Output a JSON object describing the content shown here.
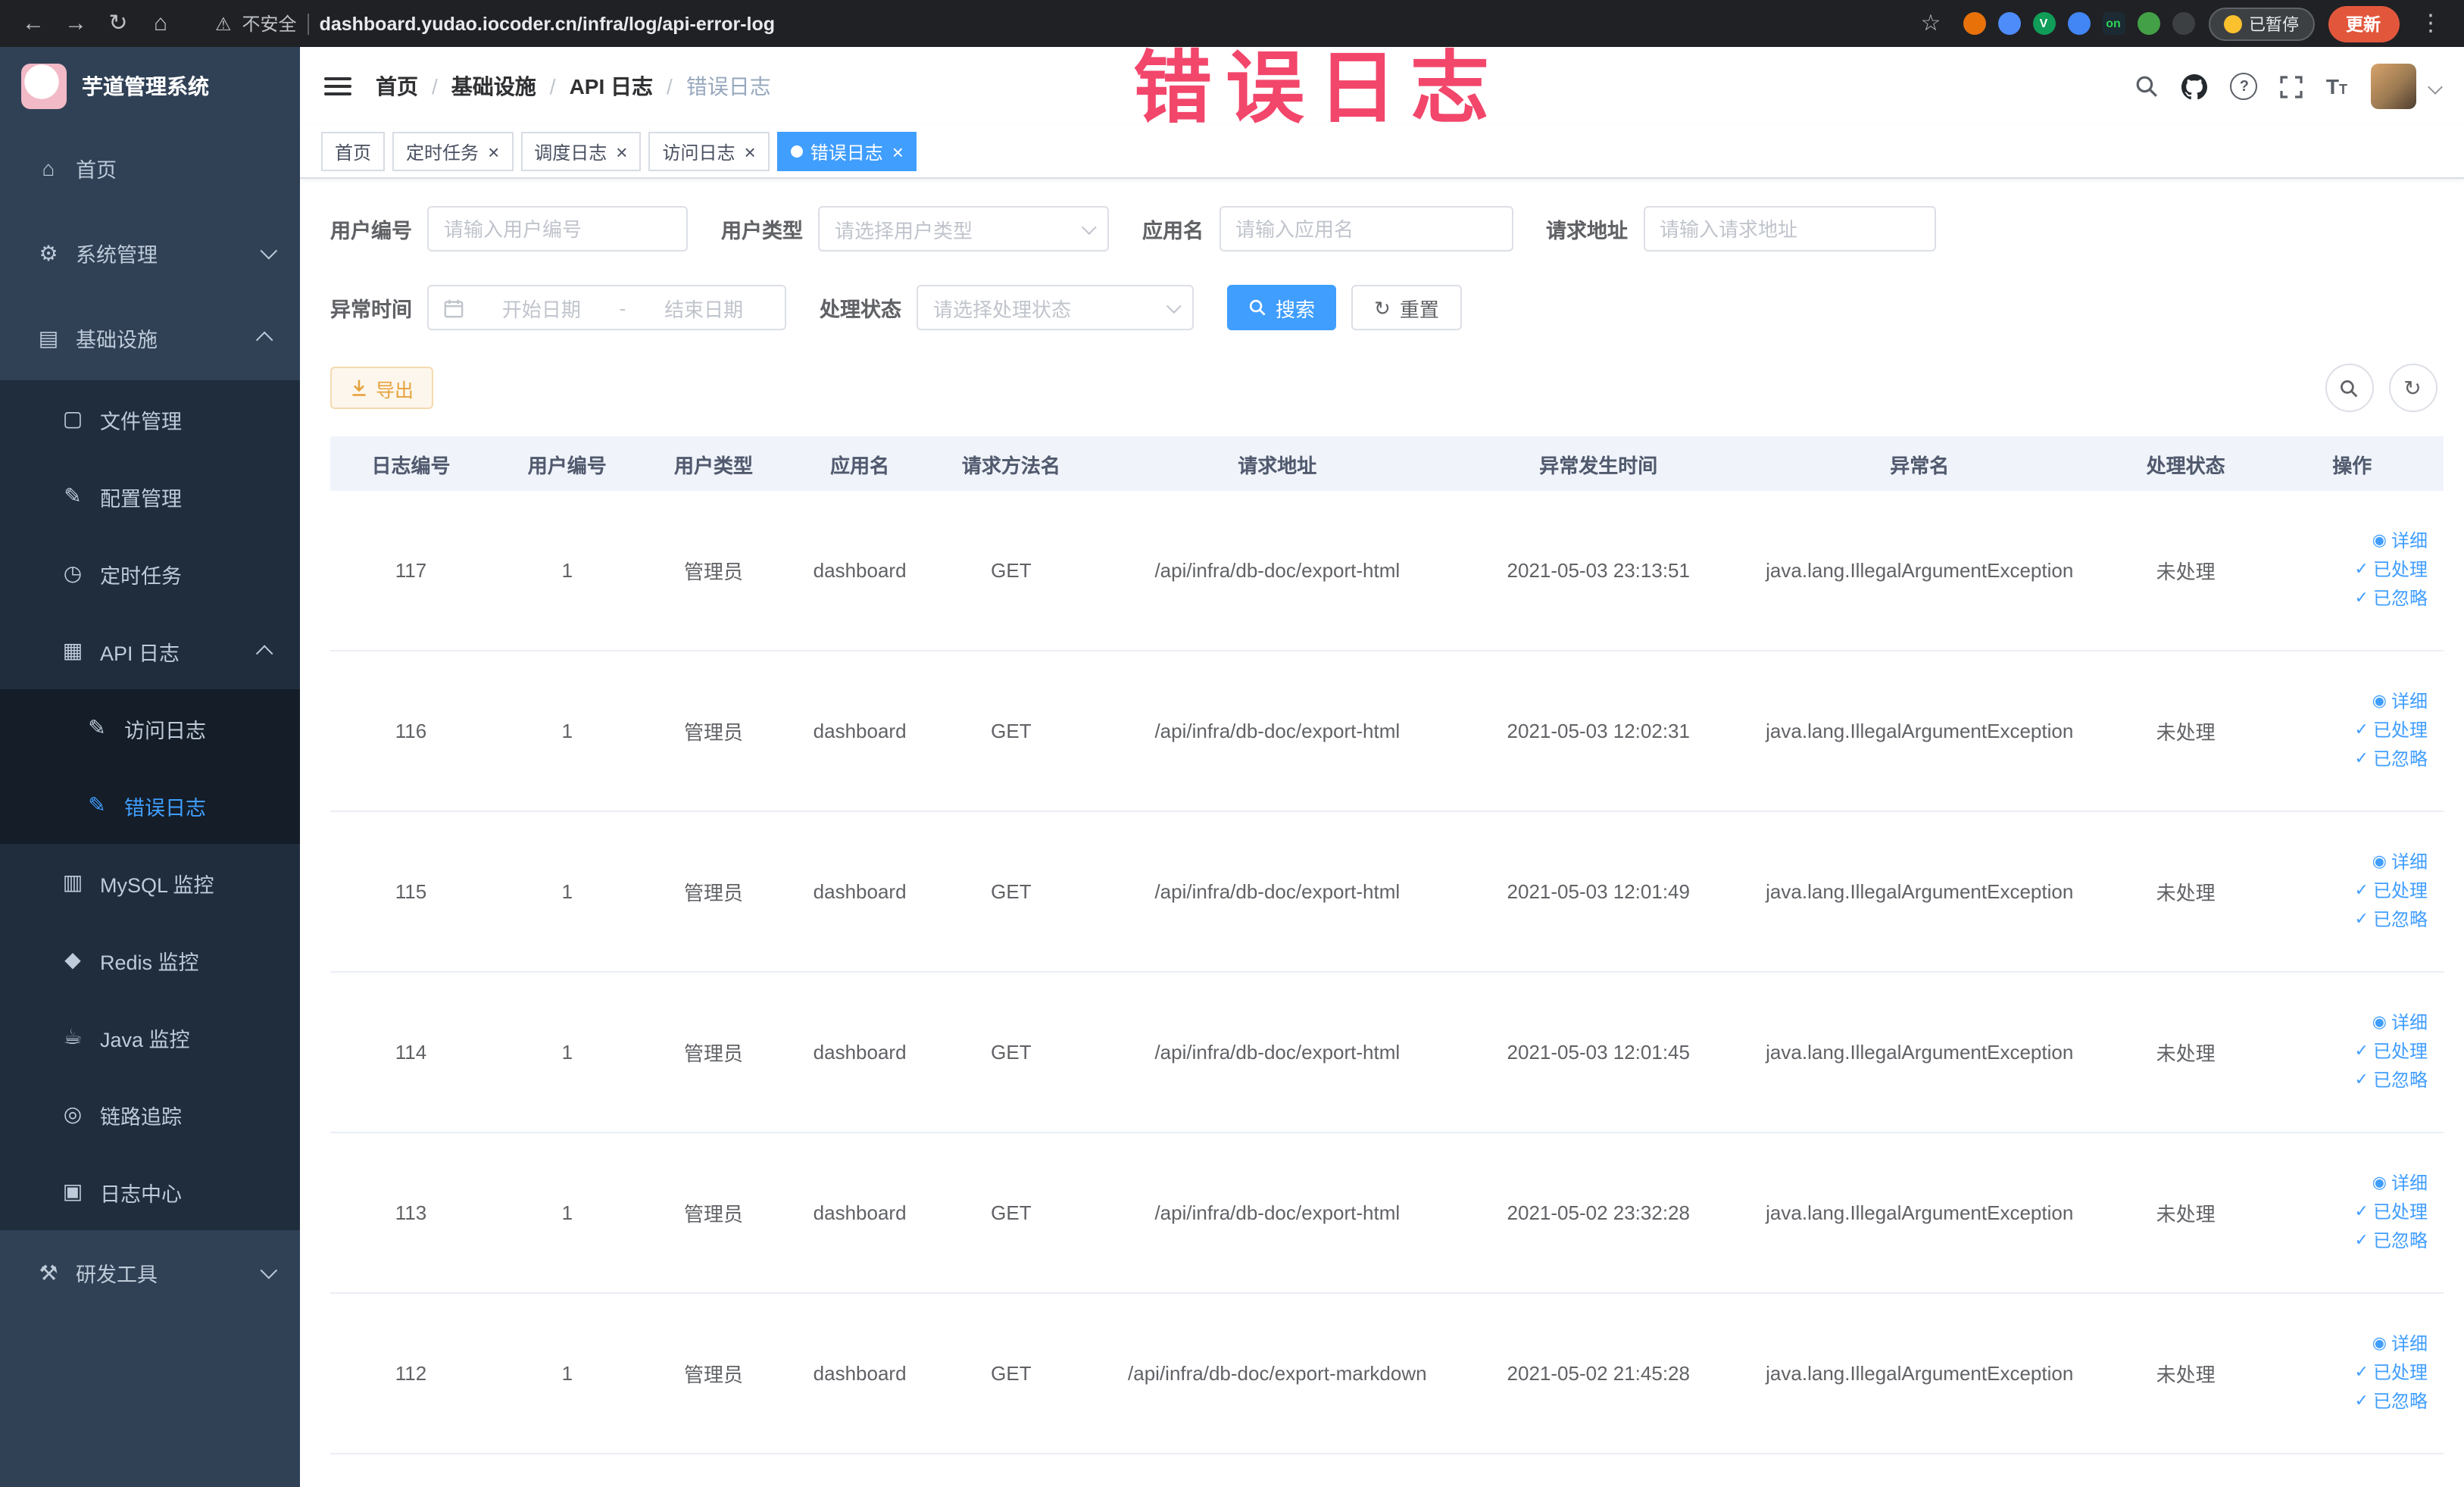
{
  "watermark": {
    "text": "错误日志",
    "color": "#f2466b"
  },
  "browser": {
    "security_label": "不安全",
    "url": "dashboard.yudao.iocoder.cn/infra/log/api-error-log",
    "paused_label": "已暂停",
    "update_label": "更新",
    "extensions": [
      {
        "name": "extension-icon-orange",
        "color": "#e8710a",
        "shape": "circle",
        "text": ""
      },
      {
        "name": "extension-icon-blue-drop",
        "color": "#4e8cf9",
        "shape": "circle",
        "text": ""
      },
      {
        "name": "extension-icon-green-v",
        "color": "#0f9d58",
        "shape": "circle",
        "text": "V"
      },
      {
        "name": "extension-icon-blue-grid",
        "color": "#4285f4",
        "shape": "circle",
        "text": ""
      },
      {
        "name": "extension-icon-switch-on",
        "color": "#1b2a33",
        "shape": "square",
        "text": "on"
      },
      {
        "name": "extension-icon-green-leaf",
        "color": "#43a047",
        "shape": "circle",
        "text": ""
      },
      {
        "name": "extension-icon-dark-pin",
        "color": "#3c4043",
        "shape": "circle",
        "text": ""
      }
    ]
  },
  "sidebar": {
    "logo_title": "芋道管理系统",
    "menu": [
      {
        "id": "home",
        "label": "首页",
        "icon": "home-icon",
        "glyph": "⌂"
      },
      {
        "id": "system",
        "label": "系统管理",
        "icon": "gear-icon",
        "glyph": "⚙",
        "expanded": false,
        "has_children": true
      },
      {
        "id": "infra",
        "label": "基础设施",
        "icon": "infrastructure-icon",
        "glyph": "▤",
        "expanded": true,
        "has_children": true,
        "children": [
          {
            "id": "file",
            "label": "文件管理",
            "icon": "file-icon",
            "glyph": "▢"
          },
          {
            "id": "config",
            "label": "配置管理",
            "icon": "edit-icon",
            "glyph": "✎"
          },
          {
            "id": "job",
            "label": "定时任务",
            "icon": "clock-icon",
            "glyph": "◷"
          },
          {
            "id": "api-log",
            "label": "API 日志",
            "icon": "document-icon",
            "glyph": "▦",
            "expanded": true,
            "has_children": true,
            "children": [
              {
                "id": "access-log",
                "label": "访问日志",
                "icon": "document-edit-icon",
                "glyph": "✎"
              },
              {
                "id": "error-log",
                "label": "错误日志",
                "icon": "document-edit-icon",
                "glyph": "✎",
                "active": true
              }
            ]
          },
          {
            "id": "mysql",
            "label": "MySQL 监控",
            "icon": "monitor-icon",
            "glyph": "▥"
          },
          {
            "id": "redis",
            "label": "Redis 监控",
            "icon": "database-icon",
            "glyph": "◆"
          },
          {
            "id": "java",
            "label": "Java 监控",
            "icon": "coffee-icon",
            "glyph": "☕"
          },
          {
            "id": "trace",
            "label": "链路追踪",
            "icon": "eye-icon",
            "glyph": "◎"
          },
          {
            "id": "log-center",
            "label": "日志中心",
            "icon": "log-center-icon",
            "glyph": "▣"
          }
        ]
      },
      {
        "id": "devtools",
        "label": "研发工具",
        "icon": "tools-icon",
        "glyph": "⚒",
        "expanded": false,
        "has_children": true
      }
    ]
  },
  "breadcrumb": [
    "首页",
    "基础设施",
    "API 日志",
    "错误日志"
  ],
  "tabs": [
    {
      "label": "首页",
      "closable": false,
      "active": false
    },
    {
      "label": "定时任务",
      "closable": true,
      "active": false
    },
    {
      "label": "调度日志",
      "closable": true,
      "active": false
    },
    {
      "label": "访问日志",
      "closable": true,
      "active": false
    },
    {
      "label": "错误日志",
      "closable": true,
      "active": true
    }
  ],
  "filters": {
    "user_id": {
      "label": "用户编号",
      "placeholder": "请输入用户编号"
    },
    "user_type": {
      "label": "用户类型",
      "placeholder": "请选择用户类型"
    },
    "app_name": {
      "label": "应用名",
      "placeholder": "请输入应用名"
    },
    "request_url": {
      "label": "请求地址",
      "placeholder": "请输入请求地址"
    },
    "exception_time": {
      "label": "异常时间",
      "start_placeholder": "开始日期",
      "separator": "-",
      "end_placeholder": "结束日期"
    },
    "process_status": {
      "label": "处理状态",
      "placeholder": "请选择处理状态"
    },
    "search_label": "搜索",
    "reset_label": "重置"
  },
  "toolbar": {
    "export_label": "导出"
  },
  "table": {
    "columns": [
      "日志编号",
      "用户编号",
      "用户类型",
      "应用名",
      "请求方法名",
      "请求地址",
      "异常发生时间",
      "异常名",
      "处理状态",
      "操作"
    ],
    "rows": [
      {
        "id": "117",
        "user_id": "1",
        "user_type": "管理员",
        "app": "dashboard",
        "method": "GET",
        "url": "/api/infra/db-doc/export-html",
        "time": "2021-05-03 23:13:51",
        "exception": "java.lang.IllegalArgumentException",
        "status": "未处理"
      },
      {
        "id": "116",
        "user_id": "1",
        "user_type": "管理员",
        "app": "dashboard",
        "method": "GET",
        "url": "/api/infra/db-doc/export-html",
        "time": "2021-05-03 12:02:31",
        "exception": "java.lang.IllegalArgumentException",
        "status": "未处理"
      },
      {
        "id": "115",
        "user_id": "1",
        "user_type": "管理员",
        "app": "dashboard",
        "method": "GET",
        "url": "/api/infra/db-doc/export-html",
        "time": "2021-05-03 12:01:49",
        "exception": "java.lang.IllegalArgumentException",
        "status": "未处理"
      },
      {
        "id": "114",
        "user_id": "1",
        "user_type": "管理员",
        "app": "dashboard",
        "method": "GET",
        "url": "/api/infra/db-doc/export-html",
        "time": "2021-05-03 12:01:45",
        "exception": "java.lang.IllegalArgumentException",
        "status": "未处理"
      },
      {
        "id": "113",
        "user_id": "1",
        "user_type": "管理员",
        "app": "dashboard",
        "method": "GET",
        "url": "/api/infra/db-doc/export-html",
        "time": "2021-05-02 23:32:28",
        "exception": "java.lang.IllegalArgumentException",
        "status": "未处理"
      },
      {
        "id": "112",
        "user_id": "1",
        "user_type": "管理员",
        "app": "dashboard",
        "method": "GET",
        "url": "/api/infra/db-doc/export-markdown",
        "time": "2021-05-02 21:45:28",
        "exception": "java.lang.IllegalArgumentException",
        "status": "未处理"
      }
    ],
    "actions": [
      "详细",
      "已处理",
      "已忽略"
    ]
  },
  "colors": {
    "primary": "#409eff",
    "warning": "#e6a23c",
    "sidebar_bg": "#304156",
    "submenu_bg": "#1f2d3d",
    "watermark": "#f2466b",
    "update_chip": "#e2573c"
  }
}
